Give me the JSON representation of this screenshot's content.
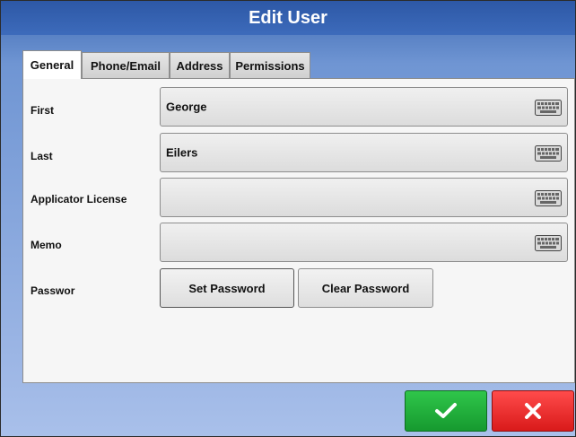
{
  "window": {
    "title": "Edit User"
  },
  "tabs": [
    {
      "label": "General",
      "active": true
    },
    {
      "label": "Phone/Email",
      "active": false
    },
    {
      "label": "Address",
      "active": false
    },
    {
      "label": "Permissions",
      "active": false
    }
  ],
  "fields": {
    "first": {
      "label": "First",
      "value": "George",
      "icon": "keyboard-icon"
    },
    "last": {
      "label": "Last",
      "value": "Eilers",
      "icon": "keyboard-icon"
    },
    "applicator_license": {
      "label": "Applicator License",
      "value": "",
      "icon": "keyboard-icon"
    },
    "memo": {
      "label": "Memo",
      "value": "",
      "icon": "keyboard-icon"
    }
  },
  "password": {
    "label": "Passwor",
    "set_label": "Set Password",
    "clear_label": "Clear Password"
  },
  "footer": {
    "ok_icon": "checkmark-icon",
    "cancel_icon": "close-icon"
  },
  "colors": {
    "accent": "#3d6bbb",
    "ok": "#1fae3a",
    "cancel": "#e52a2a"
  }
}
